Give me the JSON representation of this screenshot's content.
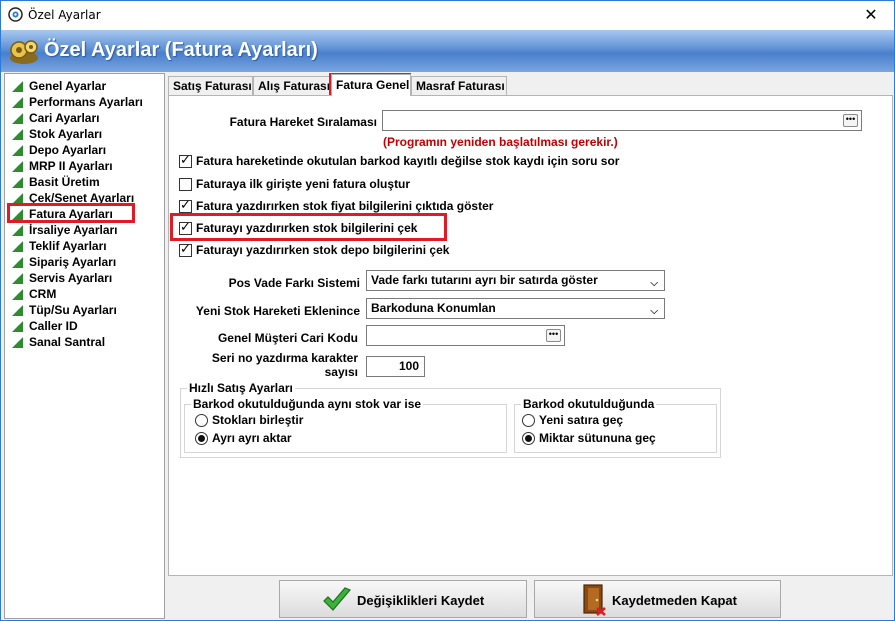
{
  "window": {
    "title": "Özel Ayarlar",
    "close_glyph": "✕"
  },
  "header": {
    "title": "Özel Ayarlar (Fatura Ayarları)"
  },
  "sidebar": {
    "items": [
      {
        "label": "Genel Ayarlar"
      },
      {
        "label": "Performans Ayarları"
      },
      {
        "label": "Cari Ayarları"
      },
      {
        "label": "Stok Ayarları"
      },
      {
        "label": "Depo Ayarları"
      },
      {
        "label": "MRP II Ayarları"
      },
      {
        "label": "Basit Üretim"
      },
      {
        "label": "Çek/Senet Ayarları"
      },
      {
        "label": "Fatura Ayarları"
      },
      {
        "label": "İrsaliye Ayarları"
      },
      {
        "label": "Teklif Ayarları"
      },
      {
        "label": "Sipariş Ayarları"
      },
      {
        "label": "Servis Ayarları"
      },
      {
        "label": "CRM"
      },
      {
        "label": "Tüp/Su Ayarları"
      },
      {
        "label": "Caller ID"
      },
      {
        "label": "Sanal Santral"
      }
    ],
    "selected": "Fatura Ayarları"
  },
  "tabs": [
    {
      "label": "Satış Faturası"
    },
    {
      "label": "Alış Faturası"
    },
    {
      "label": "Fatura Genel"
    },
    {
      "label": "Masraf Faturası"
    }
  ],
  "active_tab": "Fatura Genel",
  "form": {
    "hareket_label": "Fatura Hareket Sıralaması",
    "hareket_value": "",
    "restart_note": "(Programın yeniden başlatılması gerekir.)",
    "checkboxes": [
      {
        "label": "Fatura hareketinde okutulan barkod kayıtlı değilse stok kaydı için soru sor",
        "checked": true
      },
      {
        "label": "Faturaya ilk girişte yeni fatura oluştur",
        "checked": false
      },
      {
        "label": "Fatura yazdırırken stok fiyat bilgilerini çıktıda göster",
        "checked": true
      },
      {
        "label": "Faturayı yazdırırken stok bilgilerini çek",
        "checked": true
      },
      {
        "label": "Faturayı yazdırırken stok depo bilgilerini çek",
        "checked": true
      }
    ],
    "pos_label": "Pos Vade Farkı Sistemi",
    "pos_value": "Vade farkı tutarını ayrı bir satırda göster",
    "yeni_stok_label": "Yeni Stok Hareketi Eklenince",
    "yeni_stok_value": "Barkoduna Konumlan",
    "musteri_label": "Genel Müşteri Cari Kodu",
    "musteri_value": "",
    "seri_label_1": "Seri no yazdırma karakter",
    "seri_label_2": "sayısı",
    "seri_value": "100"
  },
  "hizli": {
    "title": "Hızlı Satış Ayarları",
    "group1": {
      "title": "Barkod okutulduğunda aynı stok var ise",
      "options": [
        {
          "label": "Stokları birleştir",
          "selected": false
        },
        {
          "label": "Ayrı ayrı aktar",
          "selected": true
        }
      ]
    },
    "group2": {
      "title": "Barkod okutulduğunda",
      "options": [
        {
          "label": "Yeni satıra geç",
          "selected": false
        },
        {
          "label": "Miktar sütununa geç",
          "selected": true
        }
      ]
    }
  },
  "buttons": {
    "save": "Değişiklikleri Kaydet",
    "close": "Kaydetmeden Kapat"
  },
  "colors": {
    "accent": "#4a7fcb",
    "highlight": "#e01b23",
    "note": "#c00000"
  }
}
